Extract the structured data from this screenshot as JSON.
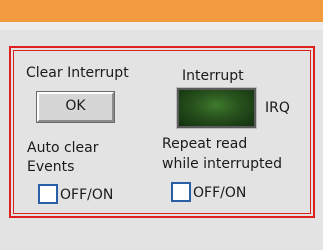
{
  "colors": {
    "accent_stripe": "#f19a3e",
    "panel_border": "#e0201c",
    "led_off": "#2a5a20",
    "checkbox_border": "#2a5fa8",
    "background": "#e3e3e3"
  },
  "clear_interrupt": {
    "label": "Clear Interrupt",
    "button_label": "OK"
  },
  "interrupt": {
    "label": "Interrupt",
    "indicator_label": "IRQ",
    "indicator_state": "off"
  },
  "auto_clear": {
    "label_line1": "Auto clear",
    "label_line2": "Events",
    "toggle_label": "OFF/ON",
    "checked": false
  },
  "repeat_read": {
    "label_line1": "Repeat read",
    "label_line2": "while interrupted",
    "toggle_label": "OFF/ON",
    "checked": false
  }
}
